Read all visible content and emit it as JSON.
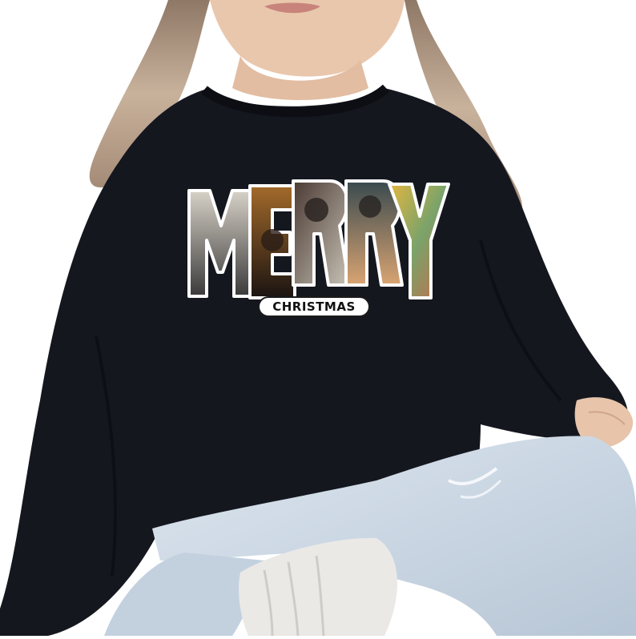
{
  "print": {
    "headline_letters": [
      "M",
      "E",
      "R",
      "R",
      "Y"
    ],
    "subline": "CHRISTMAS"
  },
  "colors": {
    "background": "#ffffff",
    "sweatshirt": "#15171f",
    "hair": "#b89b82",
    "skin": "#e6c2a8",
    "jeans": "#c9d6e3",
    "socks": "#e9e7e4"
  }
}
